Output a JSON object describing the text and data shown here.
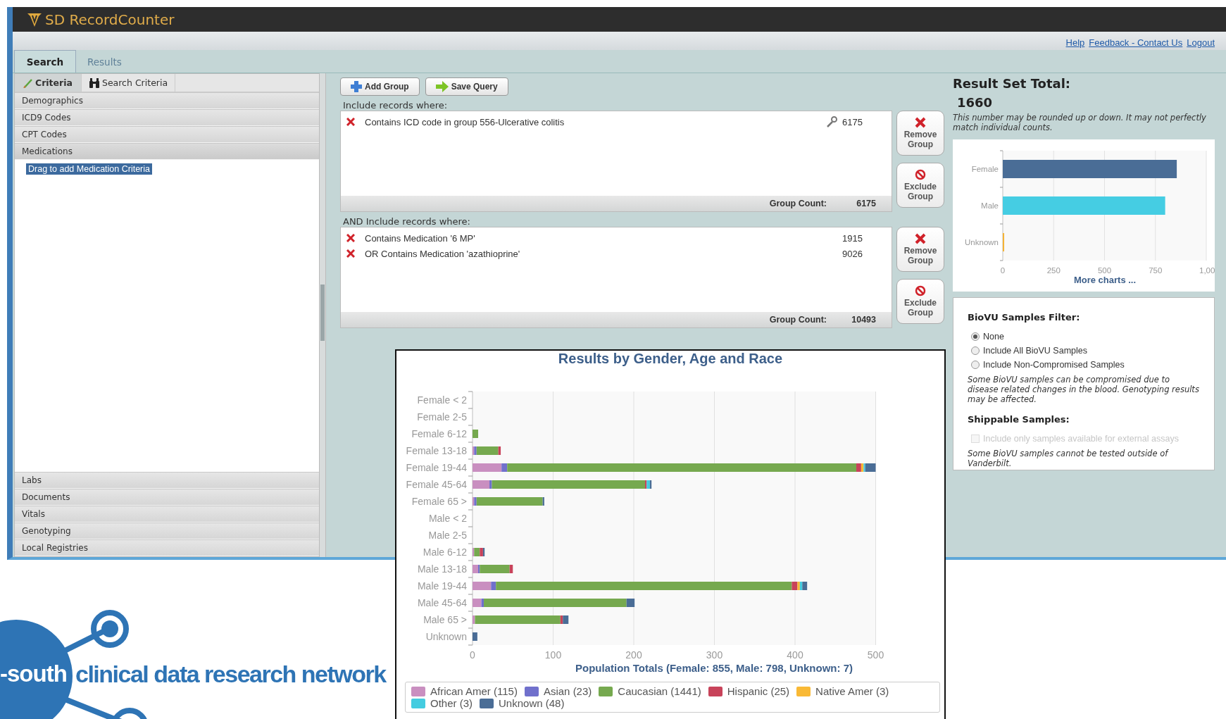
{
  "app": {
    "title": "SD RecordCounter"
  },
  "header_links": [
    "Help",
    "Feedback - Contact Us",
    "Logout"
  ],
  "tabs": [
    {
      "label": "Search",
      "selected": true
    },
    {
      "label": "Results",
      "selected": false
    }
  ],
  "sidebar": {
    "tabs": [
      {
        "label": "Criteria",
        "selected": true,
        "kind": "pencil"
      },
      {
        "label": "Search Criteria",
        "selected": false,
        "kind": "binoculars"
      }
    ],
    "sections": [
      {
        "label": "Demographics",
        "expanded": false
      },
      {
        "label": "ICD9 Codes",
        "expanded": false
      },
      {
        "label": "CPT Codes",
        "expanded": false
      },
      {
        "label": "Medications",
        "expanded": true,
        "items": [
          {
            "label": "Drag to add Medication Criteria",
            "selected": true
          }
        ]
      },
      {
        "label": "Labs",
        "expanded": false
      },
      {
        "label": "Documents",
        "expanded": false
      },
      {
        "label": "Vitals",
        "expanded": false
      },
      {
        "label": "Genotyping",
        "expanded": false
      },
      {
        "label": "Local Registries",
        "expanded": false
      }
    ]
  },
  "toolbar": [
    {
      "label": "Add Group",
      "kind": "add"
    },
    {
      "label": "Save Query",
      "kind": "save"
    }
  ],
  "groups": [
    {
      "heading": "Include records where:",
      "criteria": [
        {
          "text": "Contains ICD code in group 556-Ulcerative colitis",
          "count": "6175",
          "editable": true
        }
      ],
      "count_label": "Group Count:",
      "count": "6175",
      "buttons": [
        {
          "label": "Remove Group",
          "kind": "remove"
        },
        {
          "label": "Exclude Group",
          "kind": "exclude"
        }
      ]
    },
    {
      "heading": "AND Include records where:",
      "criteria": [
        {
          "text": "Contains Medication '6 MP'",
          "count": "1915",
          "editable": false
        },
        {
          "text": "OR Contains Medication 'azathioprine'",
          "count": "9026",
          "editable": false
        }
      ],
      "count_label": "Group Count:",
      "count": "10493",
      "buttons": [
        {
          "label": "Remove Group",
          "kind": "remove"
        },
        {
          "label": "Exclude Group",
          "kind": "exclude"
        }
      ]
    }
  ],
  "result_total": {
    "title": "Result Set Total:",
    "value": "1660",
    "note": "This number may be rounded up or down. It may not perfectly match individual counts."
  },
  "gender_chart": {
    "chart_data": {
      "type": "bar",
      "orientation": "horizontal",
      "stacked": true,
      "grid": true,
      "series": [
        {
          "name": "Female",
          "color": "#4a6d96",
          "values": [
            855,
            null,
            null
          ]
        },
        {
          "name": "Male",
          "color": "#45cde3",
          "values": [
            null,
            798,
            null
          ]
        },
        {
          "name": "Unknown",
          "color": "#f5b335",
          "values": [
            null,
            null,
            7
          ]
        }
      ],
      "xlim": [
        0,
        1000
      ],
      "xticks": [
        0,
        250,
        500,
        750
      ]
    },
    "edge_tick_label": "1,00",
    "link": "More charts ..."
  },
  "biovu": {
    "title": "BioVU Samples Filter:",
    "options": [
      {
        "label": "None",
        "selected": true
      },
      {
        "label": "Include All BioVU Samples",
        "selected": false
      },
      {
        "label": "Include Non-Compromised Samples",
        "selected": false
      }
    ],
    "note": "Some BioVU samples can be compromised due to disease related changes in the blood. Genotyping results may be affected.",
    "shippable_title": "Shippable Samples:",
    "shippable_option": {
      "label": "Include only samples available for external assays",
      "checked": false,
      "disabled": true
    },
    "shippable_note": "Some BioVU samples cannot be tested outside of Vanderbilt."
  },
  "results_popup": {
    "chart_data": {
      "type": "bar",
      "orientation": "horizontal",
      "stacked": true,
      "title": "Results by Gender, Age and Race",
      "xlabel": "Population Totals (Female: 855, Male: 798, Unknown: 7)",
      "categories": [
        "Female < 2",
        "Female 2-5",
        "Female 6-12",
        "Female 13-18",
        "Female 19-44",
        "Female 45-64",
        "Female 65 >",
        "Male < 2",
        "Male 2-5",
        "Male 6-12",
        "Male 13-18",
        "Male 19-44",
        "Male 45-64",
        "Male 65 >",
        "Unknown"
      ],
      "series": [
        {
          "name": "African Amer (115)",
          "color": "#c98fc0",
          "values": [
            0,
            0,
            0,
            2,
            36,
            21,
            2,
            0,
            0,
            2,
            7,
            23,
            11,
            3,
            0
          ]
        },
        {
          "name": "Asian (23)",
          "color": "#7070cc",
          "values": [
            0,
            0,
            0,
            3,
            7,
            3,
            3,
            0,
            0,
            0,
            2,
            6,
            3,
            0,
            0
          ]
        },
        {
          "name": "Caucasian (1441)",
          "color": "#76a94f",
          "values": [
            0,
            0,
            7,
            27,
            433,
            190,
            82,
            0,
            0,
            7,
            37,
            367,
            177,
            106,
            0
          ]
        },
        {
          "name": "Hispanic (25)",
          "color": "#c8435a",
          "values": [
            0,
            0,
            0,
            3,
            6,
            2,
            0,
            0,
            0,
            4,
            4,
            7,
            0,
            3,
            0
          ]
        },
        {
          "name": "Native Amer (3)",
          "color": "#f9b935",
          "values": [
            0,
            0,
            0,
            0,
            3,
            0,
            0,
            0,
            0,
            0,
            0,
            3,
            0,
            0,
            0
          ]
        },
        {
          "name": "Other (3)",
          "color": "#44cce0",
          "values": [
            0,
            0,
            0,
            0,
            2,
            4,
            0,
            0,
            0,
            0,
            0,
            3,
            0,
            0,
            0
          ]
        },
        {
          "name": "Unknown (48)",
          "color": "#4a6d96",
          "values": [
            0,
            0,
            0,
            0,
            13,
            2,
            2,
            0,
            0,
            2,
            0,
            6,
            10,
            7,
            6
          ]
        }
      ],
      "grid": true,
      "xlim": [
        0,
        500
      ],
      "xticks": [
        0,
        100,
        200,
        300,
        400,
        500
      ]
    }
  },
  "logo": {
    "circle_text": "-south",
    "text": "clinical data research network"
  }
}
